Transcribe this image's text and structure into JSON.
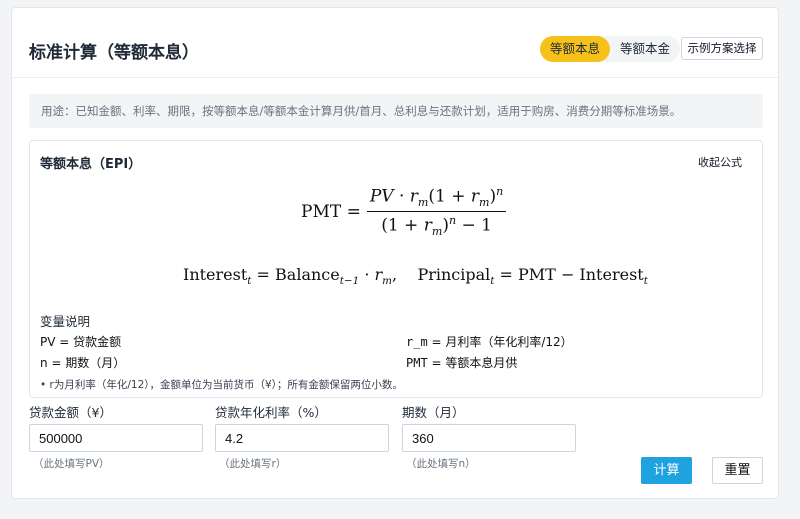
{
  "header": {
    "title": "标准计算（等额本息）",
    "modes": [
      "等额本息",
      "等额本金"
    ],
    "active_mode": "等额本息",
    "example_button": "示例方案选择"
  },
  "usage_text": "用途：已知金额、利率、期限，按等额本息/等额本金计算月供/首月、总利息与还款计划，适用于购房、消费分期等标准场景。",
  "formula": {
    "title": "等额本息（EPI）",
    "collapse_label": "收起公式",
    "vars_title": "变量说明",
    "vars": {
      "pv": "PV = 贷款金额",
      "n": "n = 期数（月）",
      "rm_key": "r_m",
      "rm_text": " = 月利率（年化利率/12）",
      "pmt_key": "PMT",
      "pmt_text": " = 等额本息月供"
    },
    "note": "• r为月利率（年化/12），金额单位为当前货币（¥）；所有金额保留两位小数。"
  },
  "fields": {
    "amount": {
      "label": "贷款金额（¥）",
      "value": "500000",
      "hint": "（此处填写PV）"
    },
    "rate": {
      "label": "贷款年化利率（%）",
      "value": "4.2",
      "hint": "（此处填写r）"
    },
    "term": {
      "label": "期数（月）",
      "value": "360",
      "hint": "（此处填写n）"
    }
  },
  "actions": {
    "calculate": "计算",
    "reset": "重置"
  }
}
